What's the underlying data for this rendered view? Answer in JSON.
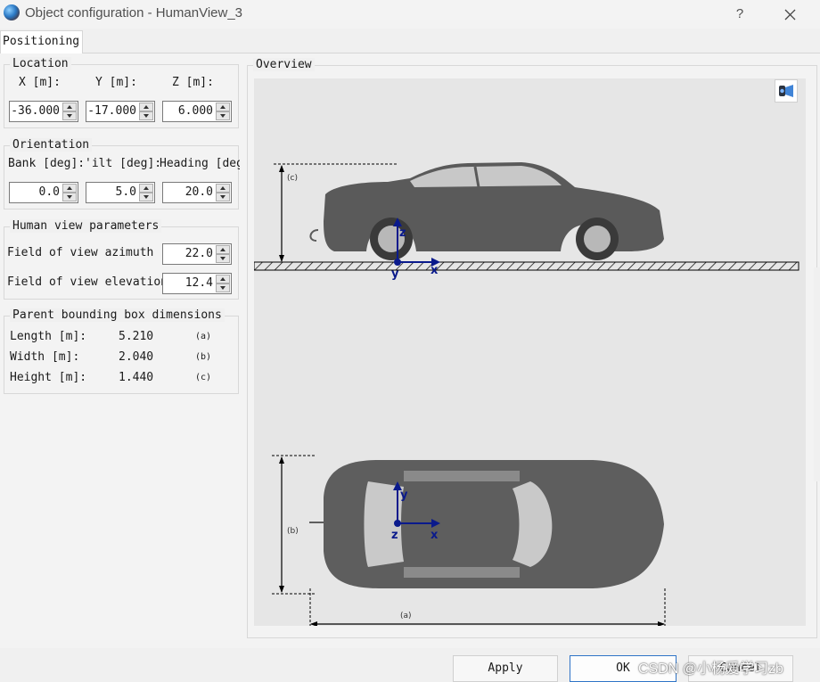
{
  "window": {
    "title": "Object configuration - HumanView_3",
    "help_label": "?"
  },
  "tabs": [
    {
      "label": "Positioning"
    }
  ],
  "location": {
    "title": "Location",
    "x_label": "X  [m]:",
    "y_label": "Y [m]:",
    "z_label": "Z [m]:",
    "x_value": "-36.000",
    "y_value": "-17.000",
    "z_value": "6.000"
  },
  "orientation": {
    "title": "Orientation",
    "bank_label": "Bank [deg]:",
    "tilt_label": "'ilt [deg]:",
    "heading_label": "Heading [deg",
    "bank_value": "0.0",
    "tilt_value": "5.0",
    "heading_value": "20.0"
  },
  "human_view": {
    "title": "Human view parameters",
    "azimuth_label": "Field of view azimuth [",
    "azimuth_value": "22.0",
    "elevation_label": "Field of view elevation",
    "elevation_value": "12.4"
  },
  "parent_bbox": {
    "title": "Parent bounding box dimensions",
    "rows": [
      {
        "label": "Length [m]:",
        "value": "5.210",
        "tag": "(a)"
      },
      {
        "label": "Width [m]:",
        "value": "2.040",
        "tag": "(b)"
      },
      {
        "label": "Height [m]:",
        "value": "1.440",
        "tag": "(c)"
      }
    ]
  },
  "overview": {
    "title": "Overview",
    "side": {
      "dim": "(c)",
      "z": "z",
      "y": "y",
      "x": "x"
    },
    "top": {
      "dim_b": "(b)",
      "dim_a": "(a)",
      "y": "y",
      "z": "z",
      "x": "x"
    },
    "axis_color": "#0a1a8c"
  },
  "buttons": {
    "apply": "Apply",
    "ok": "OK",
    "cancel": "Cancel"
  },
  "watermark": "CSDN @小杨爱学习zb"
}
